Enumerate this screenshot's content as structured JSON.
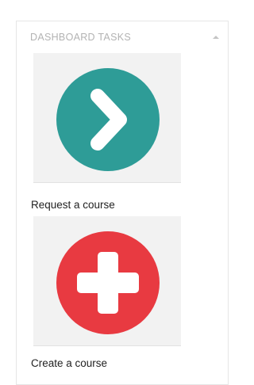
{
  "widget": {
    "title": "DASHBOARD TASKS",
    "collapse_icon": "chevron-up-icon"
  },
  "tasks": [
    {
      "label": "Request a course",
      "icon": "chevron-right-icon",
      "color": "#2e9c97"
    },
    {
      "label": "Create a course",
      "icon": "plus-icon",
      "color": "#e83a41"
    }
  ],
  "colors": {
    "title_text": "#b3b3b3",
    "tile_background": "#f2f2f2",
    "label_text": "#222222"
  }
}
